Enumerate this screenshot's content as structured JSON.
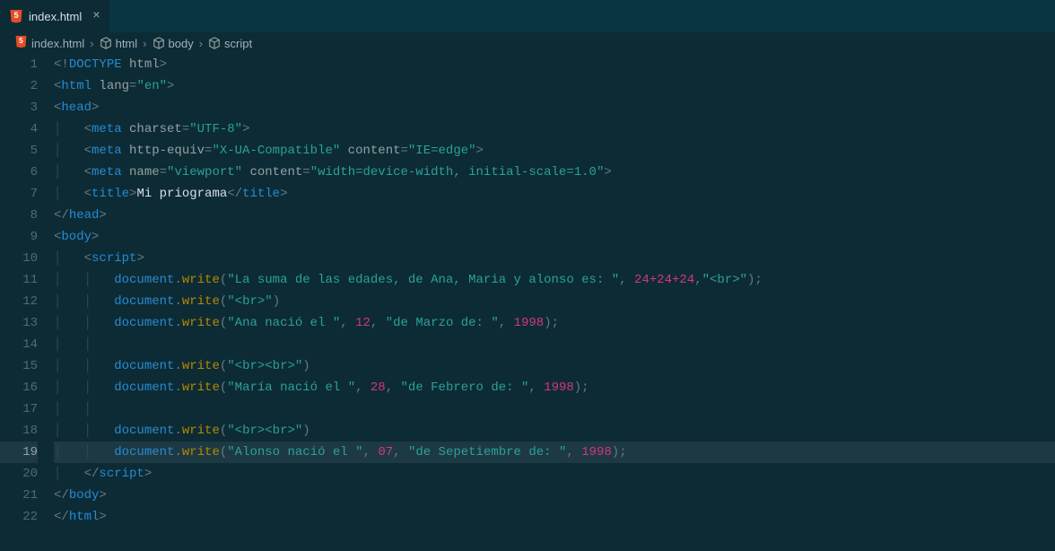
{
  "tab": {
    "label": "index.html",
    "close": "×"
  },
  "breadcrumbs": {
    "file": "index.html",
    "sep": "›",
    "path": [
      "html",
      "body",
      "script"
    ]
  },
  "gutter": [
    "1",
    "2",
    "3",
    "4",
    "5",
    "6",
    "7",
    "8",
    "9",
    "10",
    "11",
    "12",
    "13",
    "14",
    "15",
    "16",
    "17",
    "18",
    "19",
    "20",
    "21",
    "22"
  ],
  "code": {
    "l1": {
      "a": "<!",
      "b": "DOCTYPE",
      "c": " html",
      "d": ">"
    },
    "l2": {
      "a": "<",
      "b": "html",
      "c": " lang",
      "d": "=",
      "e": "\"en\"",
      "f": ">"
    },
    "l3": {
      "a": "<",
      "b": "head",
      "c": ">"
    },
    "l4": {
      "a": "<",
      "b": "meta",
      "c": " charset",
      "d": "=",
      "e": "\"UTF-8\"",
      "f": ">"
    },
    "l5": {
      "a": "<",
      "b": "meta",
      "c": " http-equiv",
      "d": "=",
      "e": "\"X-UA-Compatible\"",
      "f": " content",
      "g": "=",
      "h": "\"IE=edge\"",
      "i": ">"
    },
    "l6": {
      "a": "<",
      "b": "meta",
      "c": " name",
      "d": "=",
      "e": "\"viewport\"",
      "f": " content",
      "g": "=",
      "h": "\"width=device-width, initial-scale=1.0\"",
      "i": ">"
    },
    "l7": {
      "a": "<",
      "b": "title",
      "c": ">",
      "d": "Mi priograma",
      "e": "</",
      "f": "title",
      "g": ">"
    },
    "l8": {
      "a": "</",
      "b": "head",
      "c": ">"
    },
    "l9": {
      "a": "<",
      "b": "body",
      "c": ">"
    },
    "l10": {
      "a": "<",
      "b": "script",
      "c": ">"
    },
    "l11": {
      "a": "document",
      "b": ".",
      "c": "write",
      "d": "(",
      "e": "\"La suma de las edades, de Ana, Maria y alonso es: \"",
      "f": ", ",
      "g": "24",
      "h": "+",
      "i": "24",
      "j": "+",
      "k": "24",
      "l": ",",
      "m": "\"<br>\"",
      "n": ");"
    },
    "l12": {
      "a": "document",
      "b": ".",
      "c": "write",
      "d": "(",
      "e": "\"<br>\"",
      "f": ")"
    },
    "l13": {
      "a": "document",
      "b": ".",
      "c": "write",
      "d": "(",
      "e": "\"Ana nació el \"",
      "f": ", ",
      "g": "12",
      "h": ", ",
      "i": "\"de Marzo de: \"",
      "j": ", ",
      "k": "1998",
      "l": ");"
    },
    "l15": {
      "a": "document",
      "b": ".",
      "c": "write",
      "d": "(",
      "e": "\"<br><br>\"",
      "f": ")"
    },
    "l16": {
      "a": "document",
      "b": ".",
      "c": "write",
      "d": "(",
      "e": "\"María nació el \"",
      "f": ", ",
      "g": "28",
      "h": ", ",
      "i": "\"de Febrero de: \"",
      "j": ", ",
      "k": "1998",
      "l": ");"
    },
    "l18": {
      "a": "document",
      "b": ".",
      "c": "write",
      "d": "(",
      "e": "\"<br><br>\"",
      "f": ")"
    },
    "l19": {
      "a": "document",
      "b": ".",
      "c": "write",
      "d": "(",
      "e": "\"Alonso nació el \"",
      "f": ", ",
      "g": "07",
      "h": ", ",
      "i": "\"de Sepetiembre de: \"",
      "j": ", ",
      "k": "1998",
      "l": ");"
    },
    "l20": {
      "a": "</",
      "b": "script",
      "c": ">"
    },
    "l21": {
      "a": "</",
      "b": "body",
      "c": ">"
    },
    "l22": {
      "a": "</",
      "b": "html",
      "c": ">"
    }
  },
  "highlight_line": 19
}
